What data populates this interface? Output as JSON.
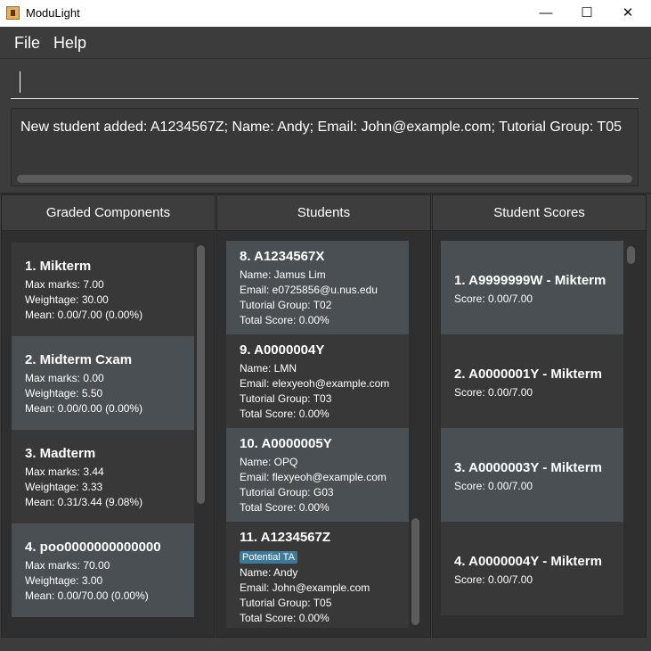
{
  "window": {
    "title": "ModuLight",
    "minimize_glyph": "—",
    "maximize_glyph": "☐",
    "close_glyph": "✕"
  },
  "menu": {
    "file": "File",
    "help": "Help"
  },
  "command": {
    "value": "",
    "placeholder": ""
  },
  "result": {
    "message": "New student added: A1234567Z; Name: Andy; Email: John@example.com; Tutorial Group: T05"
  },
  "panels": {
    "graded": {
      "header": "Graded Components",
      "items": [
        {
          "title": "1.  Mikterm",
          "max_marks": "Max marks: 7.00",
          "weightage": "Weightage: 30.00",
          "mean": "Mean: 0.00/7.00 (0.00%)"
        },
        {
          "title": "2.  Midterm Cxam",
          "max_marks": "Max marks: 0.00",
          "weightage": "Weightage: 5.50",
          "mean": "Mean: 0.00/0.00 (0.00%)"
        },
        {
          "title": "3.  Madterm",
          "max_marks": "Max marks: 3.44",
          "weightage": "Weightage: 3.33",
          "mean": "Mean: 0.31/3.44 (9.08%)"
        },
        {
          "title": "4.  poo0000000000000",
          "max_marks": "Max marks: 70.00",
          "weightage": "Weightage: 3.00",
          "mean": "Mean: 0.00/70.00 (0.00%)"
        }
      ]
    },
    "students": {
      "header": "Students",
      "items": [
        {
          "title": "8.  A1234567X",
          "name": "Name: Jamus Lim",
          "email": "Email: e0725856@u.nus.edu",
          "group": "Tutorial Group: T02",
          "score": "Total Score: 0.00%"
        },
        {
          "title": "9.  A0000004Y",
          "name": "Name: LMN",
          "email": "Email: elexyeoh@example.com",
          "group": "Tutorial Group: T03",
          "score": "Total Score: 0.00%"
        },
        {
          "title": "10.  A0000005Y",
          "name": "Name: OPQ",
          "email": "Email: flexyeoh@example.com",
          "group": "Tutorial Group: G03",
          "score": "Total Score: 0.00%"
        },
        {
          "title": "11.  A1234567Z",
          "tag": "Potential TA",
          "name": "Name: Andy",
          "email": "Email: John@example.com",
          "group": "Tutorial Group: T05",
          "score": "Total Score: 0.00%"
        }
      ]
    },
    "scores": {
      "header": "Student Scores",
      "items": [
        {
          "title": "1.  A9999999W - Mikterm",
          "score": "Score: 0.00/7.00"
        },
        {
          "title": "2.  A0000001Y - Mikterm",
          "score": "Score: 0.00/7.00"
        },
        {
          "title": "3.  A0000003Y - Mikterm",
          "score": "Score: 0.00/7.00"
        },
        {
          "title": "4.  A0000004Y - Mikterm",
          "score": "Score: 0.00/7.00"
        }
      ]
    }
  },
  "status": {
    "text": ""
  }
}
